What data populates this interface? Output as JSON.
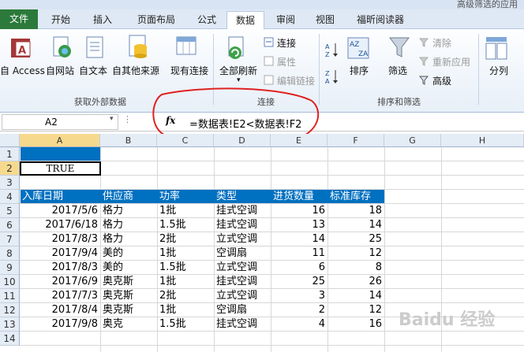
{
  "window": {
    "title_partial": "高级筛选的应用"
  },
  "tabs": [
    "文件",
    "开始",
    "插入",
    "页面布局",
    "公式",
    "数据",
    "审阅",
    "视图",
    "福昕阅读器"
  ],
  "ribbon": {
    "get_external": {
      "access": "自 Access",
      "web": "自网站",
      "text": "自文本",
      "other": "自其他来源",
      "existing": "现有连接",
      "label": "获取外部数据"
    },
    "connections": {
      "refresh_all": "全部刷新",
      "connections": "连接",
      "properties": "属性",
      "edit_links": "编辑链接",
      "label": "连接"
    },
    "sort_filter": {
      "sort": "排序",
      "filter": "筛选",
      "clear": "清除",
      "reapply": "重新应用",
      "advanced": "高级",
      "label": "排序和筛选"
    },
    "data_tools": {
      "text_to_columns": "分列"
    }
  },
  "formula_bar": {
    "name_box": "A2",
    "fx": "fx",
    "formula": "=数据表!E2<数据表!F2"
  },
  "columns": [
    "A",
    "B",
    "C",
    "D",
    "E",
    "F",
    "G",
    "H"
  ],
  "rows": [
    "1",
    "2",
    "3",
    "4",
    "5",
    "6",
    "7",
    "8",
    "9",
    "10",
    "11",
    "12",
    "13",
    "14"
  ],
  "cells": {
    "A2": "TRUE",
    "header": [
      "入库日期",
      "供应商",
      "功率",
      "类型",
      "进货数量",
      "标准库存"
    ],
    "data": [
      [
        "2017/5/6",
        "格力",
        "1批",
        "挂式空调",
        "16",
        "18"
      ],
      [
        "2017/6/18",
        "格力",
        "1.5批",
        "挂式空调",
        "13",
        "14"
      ],
      [
        "2017/8/3",
        "格力",
        "2批",
        "立式空调",
        "14",
        "25"
      ],
      [
        "2017/9/4",
        "美的",
        "1批",
        "空调扇",
        "11",
        "12"
      ],
      [
        "2017/8/3",
        "美的",
        "1.5批",
        "立式空调",
        "6",
        "8"
      ],
      [
        "2017/6/9",
        "奥克斯",
        "1批",
        "挂式空调",
        "25",
        "26"
      ],
      [
        "2017/7/3",
        "奥克斯",
        "2批",
        "立式空调",
        "3",
        "14"
      ],
      [
        "2017/8/4",
        "奥克斯",
        "1批",
        "空调扇",
        "2",
        "12"
      ],
      [
        "2017/9/8",
        "奥克",
        "1.5批",
        "挂式空调",
        "4",
        "16"
      ]
    ]
  },
  "colors": {
    "header_fill": "#0070c0",
    "a1_fill": "#0070c0",
    "annotation": "#e02020"
  },
  "watermark": "Baidu 经验"
}
